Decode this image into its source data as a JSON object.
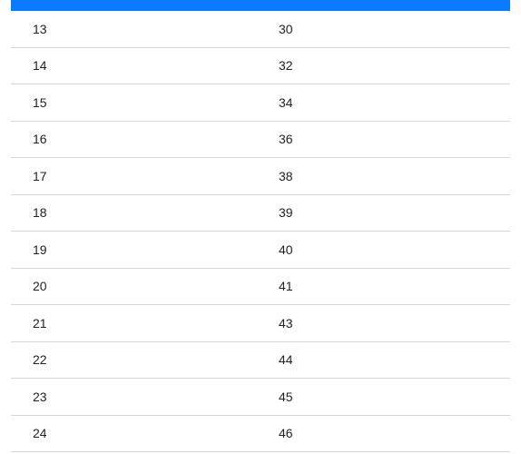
{
  "table": {
    "rows": [
      {
        "left": "13",
        "right": "30"
      },
      {
        "left": "14",
        "right": "32"
      },
      {
        "left": "15",
        "right": "34"
      },
      {
        "left": "16",
        "right": "36"
      },
      {
        "left": "17",
        "right": "38"
      },
      {
        "left": "18",
        "right": "39"
      },
      {
        "left": "19",
        "right": "40"
      },
      {
        "left": "20",
        "right": "41"
      },
      {
        "left": "21",
        "right": "43"
      },
      {
        "left": "22",
        "right": "44"
      },
      {
        "left": "23",
        "right": "45"
      },
      {
        "left": "24",
        "right": "46"
      }
    ]
  }
}
